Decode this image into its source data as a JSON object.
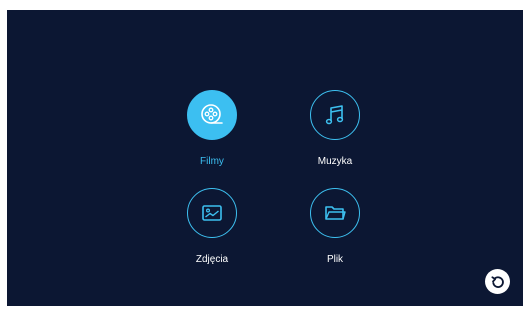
{
  "menu": {
    "items": [
      {
        "label": "Filmy",
        "icon": "film-reel-icon",
        "selected": true
      },
      {
        "label": "Muzyka",
        "icon": "music-note-icon",
        "selected": false
      },
      {
        "label": "Zdjęcia",
        "icon": "image-icon",
        "selected": false
      },
      {
        "label": "Plik",
        "icon": "folder-icon",
        "selected": false
      }
    ]
  },
  "back_button": {
    "icon": "back-arrow-icon"
  },
  "colors": {
    "background": "#0c1733",
    "accent": "#3cbff1",
    "text": "#ffffff"
  }
}
